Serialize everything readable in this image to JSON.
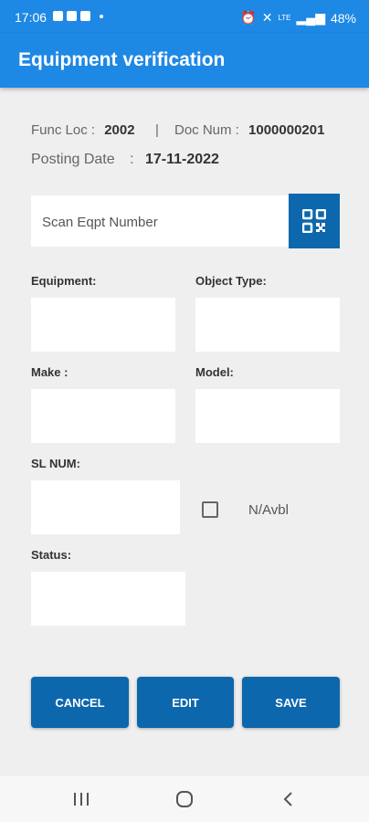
{
  "status_bar": {
    "time": "17:06",
    "network_label": "LTE",
    "battery": "48%"
  },
  "app_bar": {
    "title": "Equipment verification"
  },
  "header": {
    "func_loc_label": "Func Loc :",
    "func_loc_value": "2002",
    "separator": "|",
    "doc_num_label": "Doc Num :",
    "doc_num_value": "1000000201",
    "posting_date_label": "Posting Date",
    "posting_date_colon": ":",
    "posting_date_value": "17-11-2022"
  },
  "scan": {
    "placeholder": "Scan Eqpt Number",
    "button_icon": "qr-code-icon"
  },
  "form": {
    "equipment_label": "Equipment:",
    "equipment_value": "",
    "object_type_label": "Object Type:",
    "object_type_value": "",
    "make_label": "Make :",
    "make_value": "",
    "model_label": "Model:",
    "model_value": "",
    "sl_num_label": "SL NUM:",
    "sl_num_value": "",
    "na_label": "N/Avbl",
    "na_checked": false,
    "status_label": "Status:",
    "status_value": ""
  },
  "actions": {
    "cancel": "CANCEL",
    "edit": "EDIT",
    "save": "SAVE"
  },
  "colors": {
    "primary": "#1e88e5",
    "button": "#0d67ad",
    "background": "#efefef"
  }
}
